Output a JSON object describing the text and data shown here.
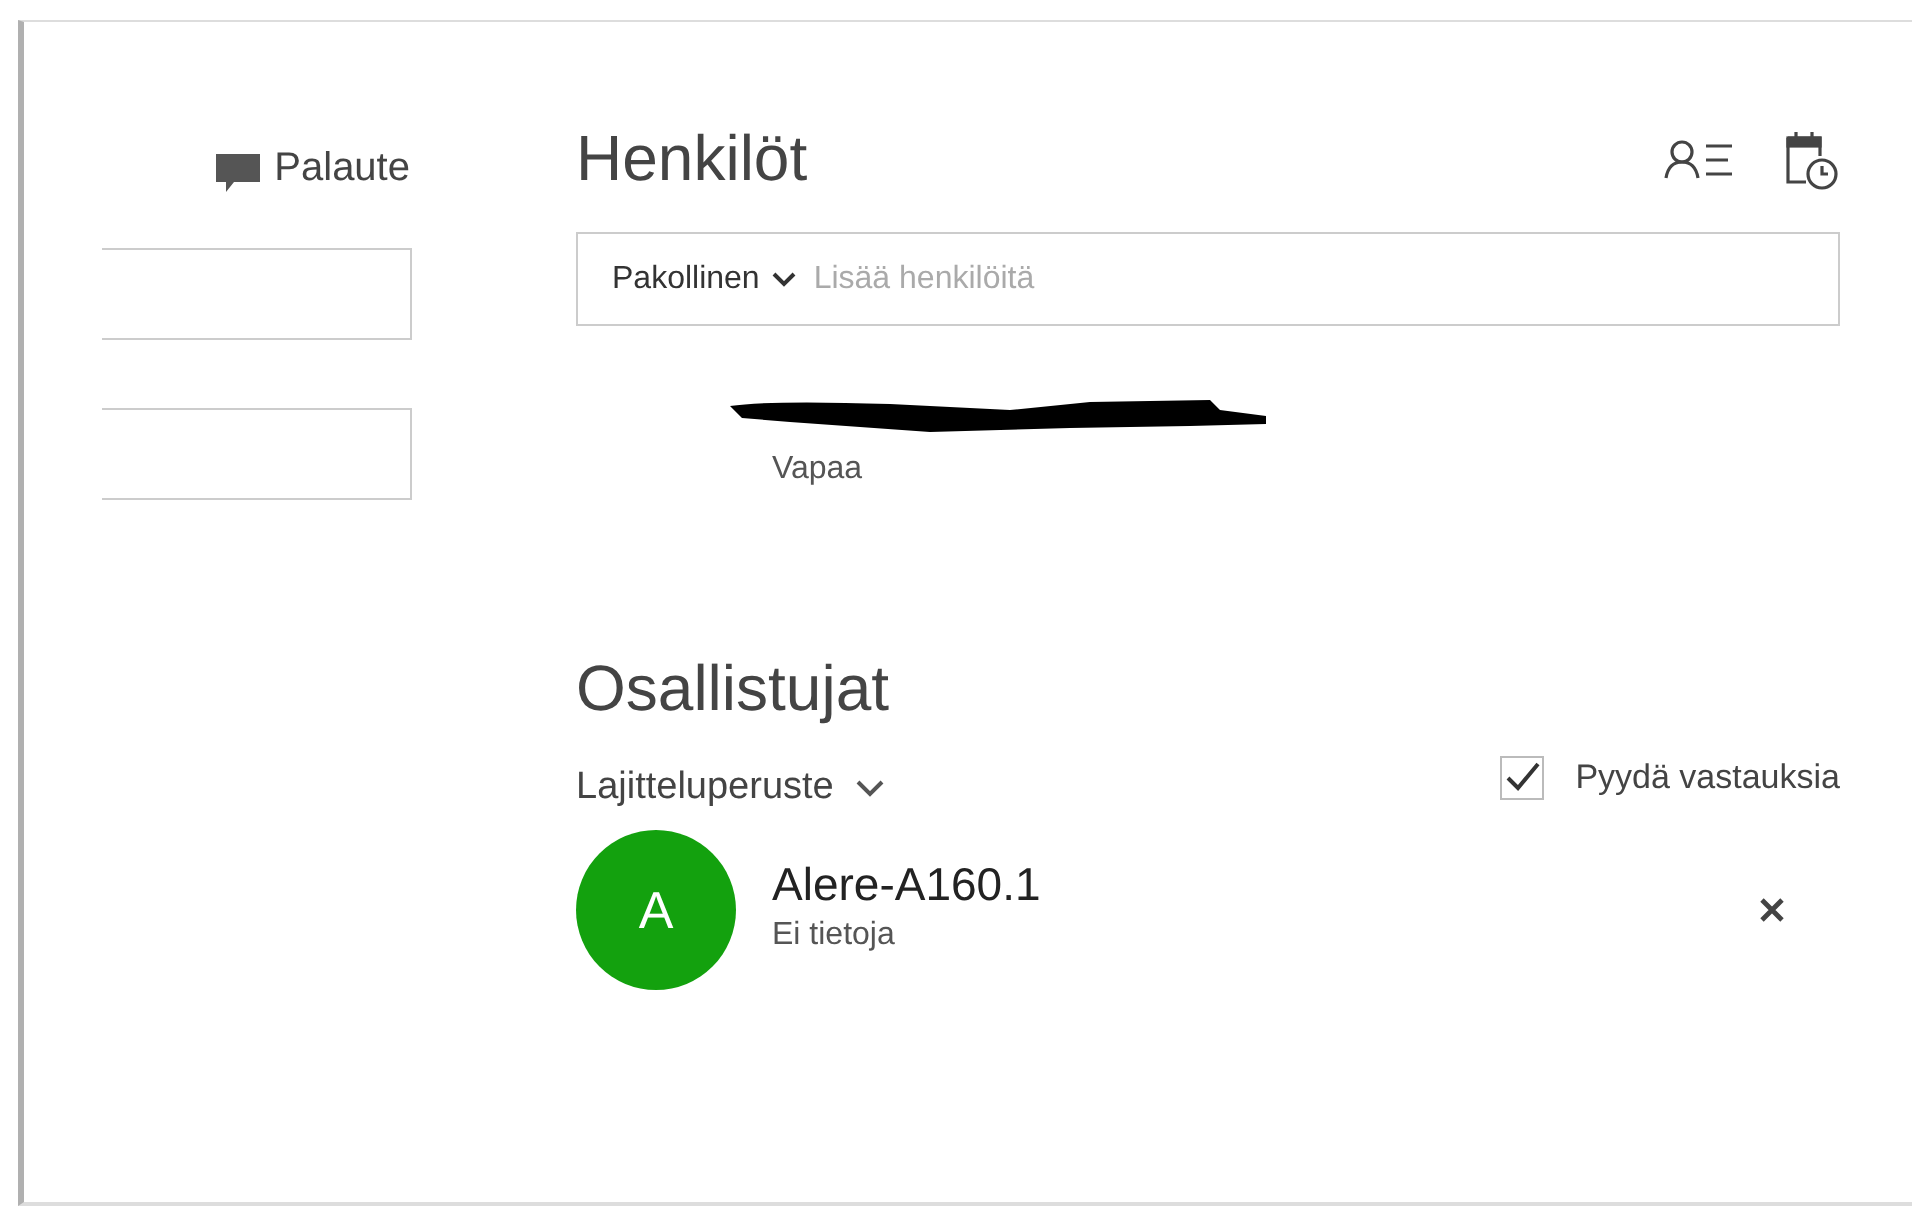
{
  "feedback": {
    "label": "Palaute"
  },
  "left_fields": [
    {
      "kind": "text"
    },
    {
      "kind": "text"
    }
  ],
  "people": {
    "title": "Henkilöt",
    "attendance": {
      "label": "Pakollinen",
      "placeholder": "Lisää henkilöitä"
    },
    "suggested": [
      {
        "redacted": true,
        "status": "Vapaa"
      }
    ]
  },
  "participants": {
    "title": "Osallistujat",
    "sort": {
      "label": "Lajitteluperuste"
    },
    "request_responses": {
      "label": "Pyydä vastauksia",
      "checked": true
    },
    "list": [
      {
        "initial": "A",
        "color": "#13a10e",
        "name": "Alere-A160.1",
        "status": "Ei tietoja"
      }
    ]
  }
}
